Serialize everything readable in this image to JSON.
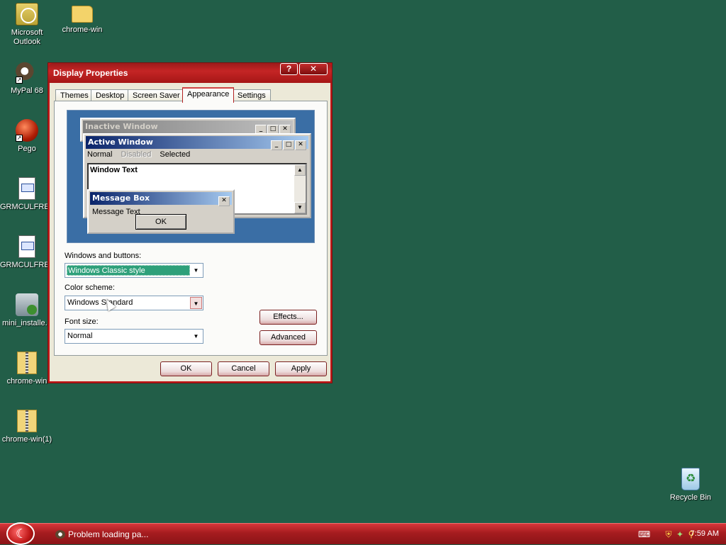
{
  "desktop": {
    "icons": [
      {
        "label": "Microsoft Outlook",
        "icon": "outlook-icon"
      },
      {
        "label": "chrome-win",
        "icon": "folder-icon"
      },
      {
        "label": "MyPal 68",
        "icon": "mypal-icon"
      },
      {
        "label": "Pego",
        "icon": "pego-icon"
      },
      {
        "label": "GRMCULFRE...",
        "icon": "document-icon"
      },
      {
        "label": "GRMCULFRE...",
        "icon": "document-icon"
      },
      {
        "label": "mini_installe...",
        "icon": "installer-icon"
      },
      {
        "label": "chrome-win",
        "icon": "zip-folder-icon"
      },
      {
        "label": "chrome-win(1)",
        "icon": "zip-folder-icon"
      },
      {
        "label": "Recycle Bin",
        "icon": "recycle-bin-icon"
      }
    ]
  },
  "dialog": {
    "title": "Display Properties",
    "help_label": "?",
    "close_label": "✕",
    "tabs": [
      "Themes",
      "Desktop",
      "Screen Saver",
      "Appearance",
      "Settings"
    ],
    "active_tab": "Appearance",
    "preview": {
      "inactive_title": "Inactive Window",
      "active_title": "Active Window",
      "menu": {
        "normal": "Normal",
        "disabled": "Disabled",
        "selected": "Selected"
      },
      "window_text": "Window Text",
      "message_box_title": "Message Box",
      "message_text": "Message Text",
      "ok_label": "OK",
      "min_glyph": "_",
      "max_glyph": "□",
      "close_glyph": "✕"
    },
    "windows_buttons": {
      "label": "Windows and buttons:",
      "value": "Windows Classic style"
    },
    "color_scheme": {
      "label": "Color scheme:",
      "value": "Windows Standard"
    },
    "font_size": {
      "label": "Font size:",
      "value": "Normal"
    },
    "effects_label": "Effects...",
    "advanced_label": "Advanced",
    "ok_label": "OK",
    "cancel_label": "Cancel",
    "apply_label": "Apply"
  },
  "taskbar": {
    "task_label": "Problem loading pa...",
    "clock": "7:59 AM"
  },
  "colors": {
    "desktop": "#225e48",
    "theme_red": "#b71c1c",
    "selection": "#2ea07a"
  }
}
